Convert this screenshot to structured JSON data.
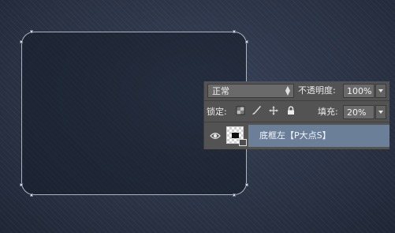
{
  "layers_panel": {
    "blend_mode": "正常",
    "opacity_label": "不透明度:",
    "opacity_value": "100%",
    "lock_label": "锁定:",
    "fill_label": "填充:",
    "fill_value": "20%",
    "lock_icons": [
      "checker-lock-icon",
      "brush-icon",
      "move-icon",
      "lock-icon"
    ],
    "layer": {
      "name": "底框左【P大点S】",
      "visible": true,
      "selected": true
    }
  },
  "canvas": {
    "shape": "rounded-rectangle",
    "stroke_color": "#dce4f0",
    "background_color": "#2b3446",
    "selection_color": "#6b7f99"
  }
}
